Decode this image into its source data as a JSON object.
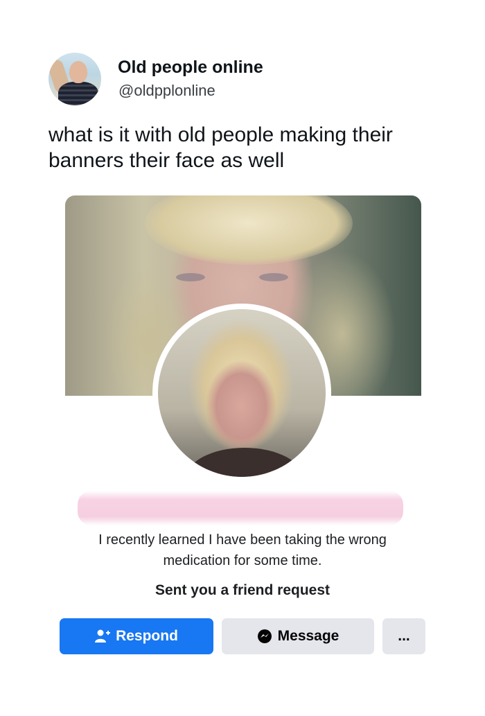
{
  "tweet": {
    "name": "Old people online",
    "handle": "@oldpplonline",
    "text": "what is it with old people making their banners their face as well"
  },
  "profile_card": {
    "bio": "I recently learned I have been taking the wrong medication for some time.",
    "status": "Sent you a friend request",
    "buttons": {
      "respond_label": "Respond",
      "message_label": "Message",
      "more_label": "..."
    },
    "icons": {
      "respond": "person-add-icon",
      "message": "messenger-icon",
      "more": "more-options-icon"
    },
    "colors": {
      "primary": "#1877f2",
      "secondary": "#e4e6eb"
    }
  }
}
